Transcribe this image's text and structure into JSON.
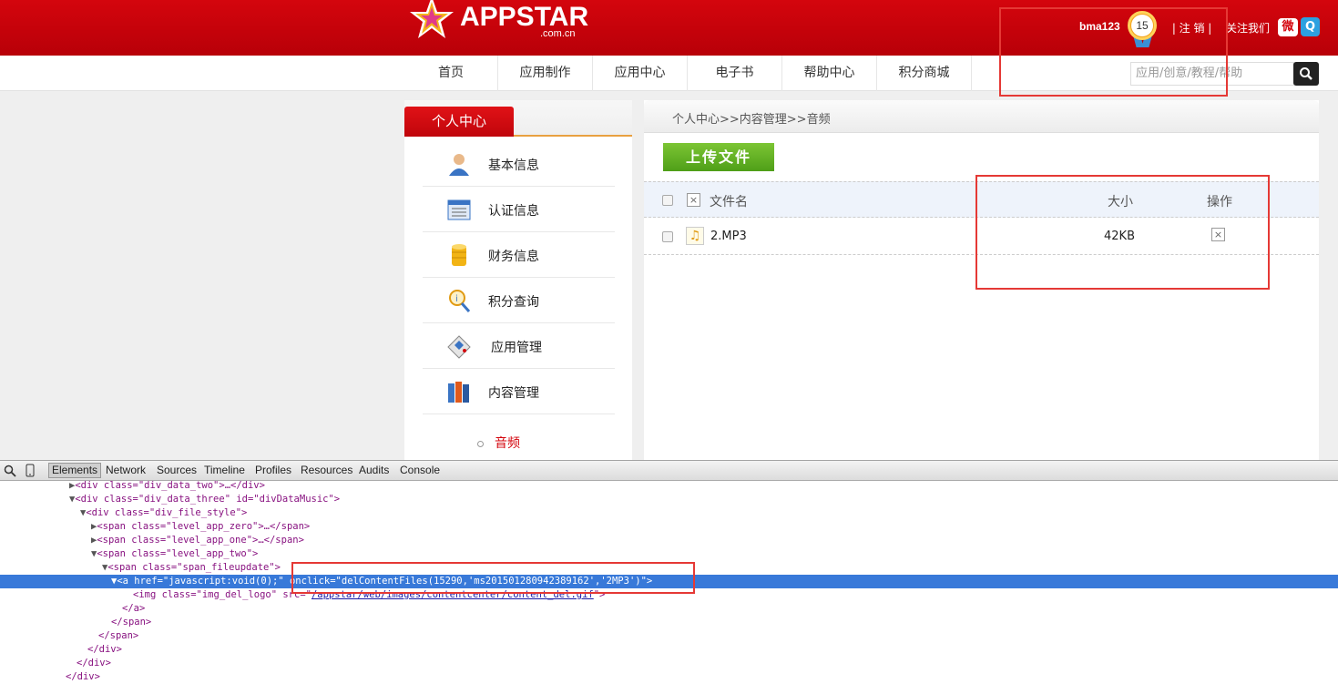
{
  "header": {
    "logo_text": "APPSTAR",
    "logo_sub": ".com.cn",
    "username": "bma123",
    "level": "15",
    "logout": " | 注 销 | ",
    "follow": "关注我们",
    "weibo_icon": "weibo-icon",
    "tencent_icon": "tencent-weibo-icon"
  },
  "nav": {
    "items": [
      "首页",
      "应用制作",
      "应用中心",
      "电子书",
      "帮助中心",
      "积分商城"
    ],
    "search_placeholder": "应用/创意/教程/帮助",
    "search_icon": "search-icon"
  },
  "sidebar": {
    "title": "个人中心",
    "items": [
      {
        "label": "基本信息",
        "icon": "user-icon"
      },
      {
        "label": "认证信息",
        "icon": "certificate-icon"
      },
      {
        "label": "财务信息",
        "icon": "coins-icon"
      },
      {
        "label": "积分查询",
        "icon": "magnifier-icon"
      },
      {
        "label": "应用管理",
        "icon": "calculator-icon"
      },
      {
        "label": "内容管理",
        "icon": "books-icon"
      }
    ],
    "sub_item": "音频"
  },
  "content": {
    "breadcrumb": "个人中心>>内容管理>>音频",
    "upload_button": "上传文件",
    "columns": {
      "name": "文件名",
      "size": "大小",
      "action": "操作"
    },
    "rows": [
      {
        "name": "2.MP3",
        "size": "42KB"
      }
    ],
    "delete_glyph": "×"
  },
  "devtools": {
    "tabs": [
      "Elements",
      "Network",
      "Sources",
      "Timeline",
      "Profiles",
      "Resources",
      "Audits",
      "Console"
    ],
    "lines": {
      "l1": "<div class=\"div_data_two\">…</div>",
      "l2_tag": "<div class=\"div_data_three\" id=\"divDataMusic\">",
      "l3": "<div class=\"div_file_style\">",
      "l4": "<span class=\"level_app_zero\">…</span>",
      "l5": "<span class=\"level_app_one\">…</span>",
      "l6": "<span class=\"level_app_two\">",
      "l7": "<span class=\"span_fileupdate\">",
      "l8a": "<a href=\"javascript:void(0);\"",
      "l8b": " onclick=\"delContentFiles(15290,'ms201501280942389162','2MP3')\">",
      "l9a": "<img class=\"img_del_logo\" src=\"",
      "l9b": "/appstar/web/images/contentcenter/content_del.gif",
      "l9c": "\">",
      "l10": "</a>",
      "l11": "</span>",
      "l12": "</span>",
      "l13": "</div>",
      "l14": "</div>",
      "l15": "</div>"
    }
  },
  "colors": {
    "brand_red": "#d4050d",
    "upload_green": "#5fae22",
    "selection_blue": "#3879d9",
    "annotation_red": "#e53935"
  }
}
